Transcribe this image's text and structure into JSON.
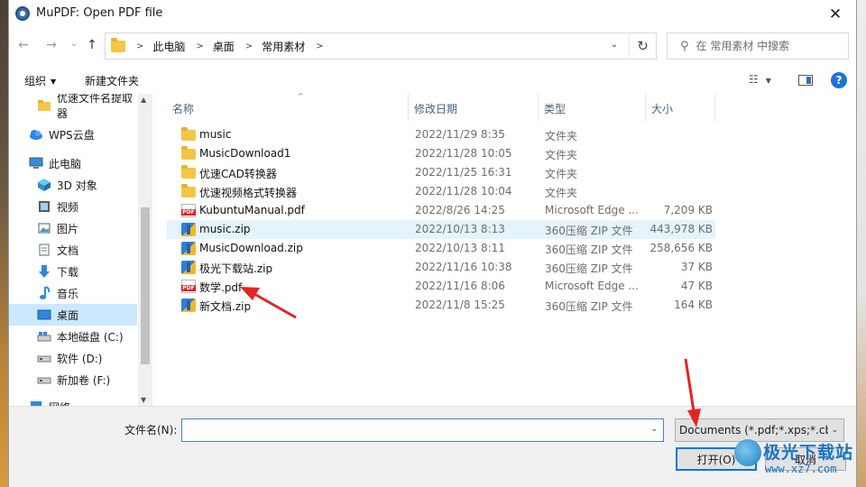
{
  "window": {
    "title": "MuPDF: Open PDF file",
    "close_glyph": "✕"
  },
  "nav": {
    "back_glyph": "←",
    "forward_glyph": "→",
    "history_glyph": "⌄",
    "up_glyph": "↑",
    "breadcrumb": [
      "此电脑",
      "桌面",
      "常用素材"
    ],
    "refresh_glyph": "↻",
    "search_placeholder": "在 常用素材 中搜索"
  },
  "toolbar": {
    "organize": "组织",
    "new_folder": "新建文件夹",
    "help": "?"
  },
  "sidebar": {
    "items": [
      {
        "label": "优速文件名提取器",
        "icon": "folder-icon"
      },
      {
        "label": "WPS云盘",
        "icon": "cloud-icon"
      },
      {
        "label": "此电脑",
        "icon": "computer-icon"
      },
      {
        "label": "3D 对象",
        "icon": "3d-objects-icon"
      },
      {
        "label": "视频",
        "icon": "video-icon"
      },
      {
        "label": "图片",
        "icon": "pictures-icon"
      },
      {
        "label": "文档",
        "icon": "documents-icon"
      },
      {
        "label": "下载",
        "icon": "download-icon"
      },
      {
        "label": "音乐",
        "icon": "music-icon"
      },
      {
        "label": "桌面",
        "icon": "desktop-icon",
        "selected": true
      },
      {
        "label": "本地磁盘 (C:)",
        "icon": "drive-c-icon"
      },
      {
        "label": "软件 (D:)",
        "icon": "drive-icon"
      },
      {
        "label": "新加卷 (F:)",
        "icon": "drive-icon"
      },
      {
        "label": "网络",
        "icon": "network-icon"
      }
    ]
  },
  "columns": {
    "name": "名称",
    "date": "修改日期",
    "type": "类型",
    "size": "大小"
  },
  "files": [
    {
      "name": "music",
      "date": "2022/11/29 8:35",
      "type": "文件夹",
      "size": "",
      "kind": "folder"
    },
    {
      "name": "MusicDownload1",
      "date": "2022/11/28 10:05",
      "type": "文件夹",
      "size": "",
      "kind": "folder"
    },
    {
      "name": "优速CAD转换器",
      "date": "2022/11/25 16:31",
      "type": "文件夹",
      "size": "",
      "kind": "folder"
    },
    {
      "name": "优速视频格式转换器",
      "date": "2022/11/28 10:04",
      "type": "文件夹",
      "size": "",
      "kind": "folder"
    },
    {
      "name": "KubuntuManual.pdf",
      "date": "2022/8/26 14:25",
      "type": "Microsoft Edge ...",
      "size": "7,209 KB",
      "kind": "pdf"
    },
    {
      "name": "music.zip",
      "date": "2022/10/13 8:13",
      "type": "360压缩 ZIP 文件",
      "size": "443,978 KB",
      "kind": "zip",
      "highlighted": true
    },
    {
      "name": "MusicDownload.zip",
      "date": "2022/10/13 8:11",
      "type": "360压缩 ZIP 文件",
      "size": "258,656 KB",
      "kind": "zip"
    },
    {
      "name": "极光下载站.zip",
      "date": "2022/11/16 10:38",
      "type": "360压缩 ZIP 文件",
      "size": "37 KB",
      "kind": "zip"
    },
    {
      "name": "数学.pdf",
      "date": "2022/11/16 8:06",
      "type": "Microsoft Edge ...",
      "size": "47 KB",
      "kind": "pdf"
    },
    {
      "name": "新文档.zip",
      "date": "2022/11/8 15:25",
      "type": "360压缩 ZIP 文件",
      "size": "164 KB",
      "kind": "zip"
    }
  ],
  "bottom": {
    "filename_label": "文件名(N):",
    "filename_value": "",
    "filter": "Documents (*.pdf;*.xps;*.cbz",
    "open_button": "打开(O)",
    "cancel_button": "取消"
  },
  "watermark": {
    "title": "极光下载站",
    "url": "www.xz7.com"
  },
  "colors": {
    "accent": "#0078d7",
    "selection": "#cce8ff",
    "hover": "#e5f3ff",
    "annotation_arrow": "#e52323"
  }
}
